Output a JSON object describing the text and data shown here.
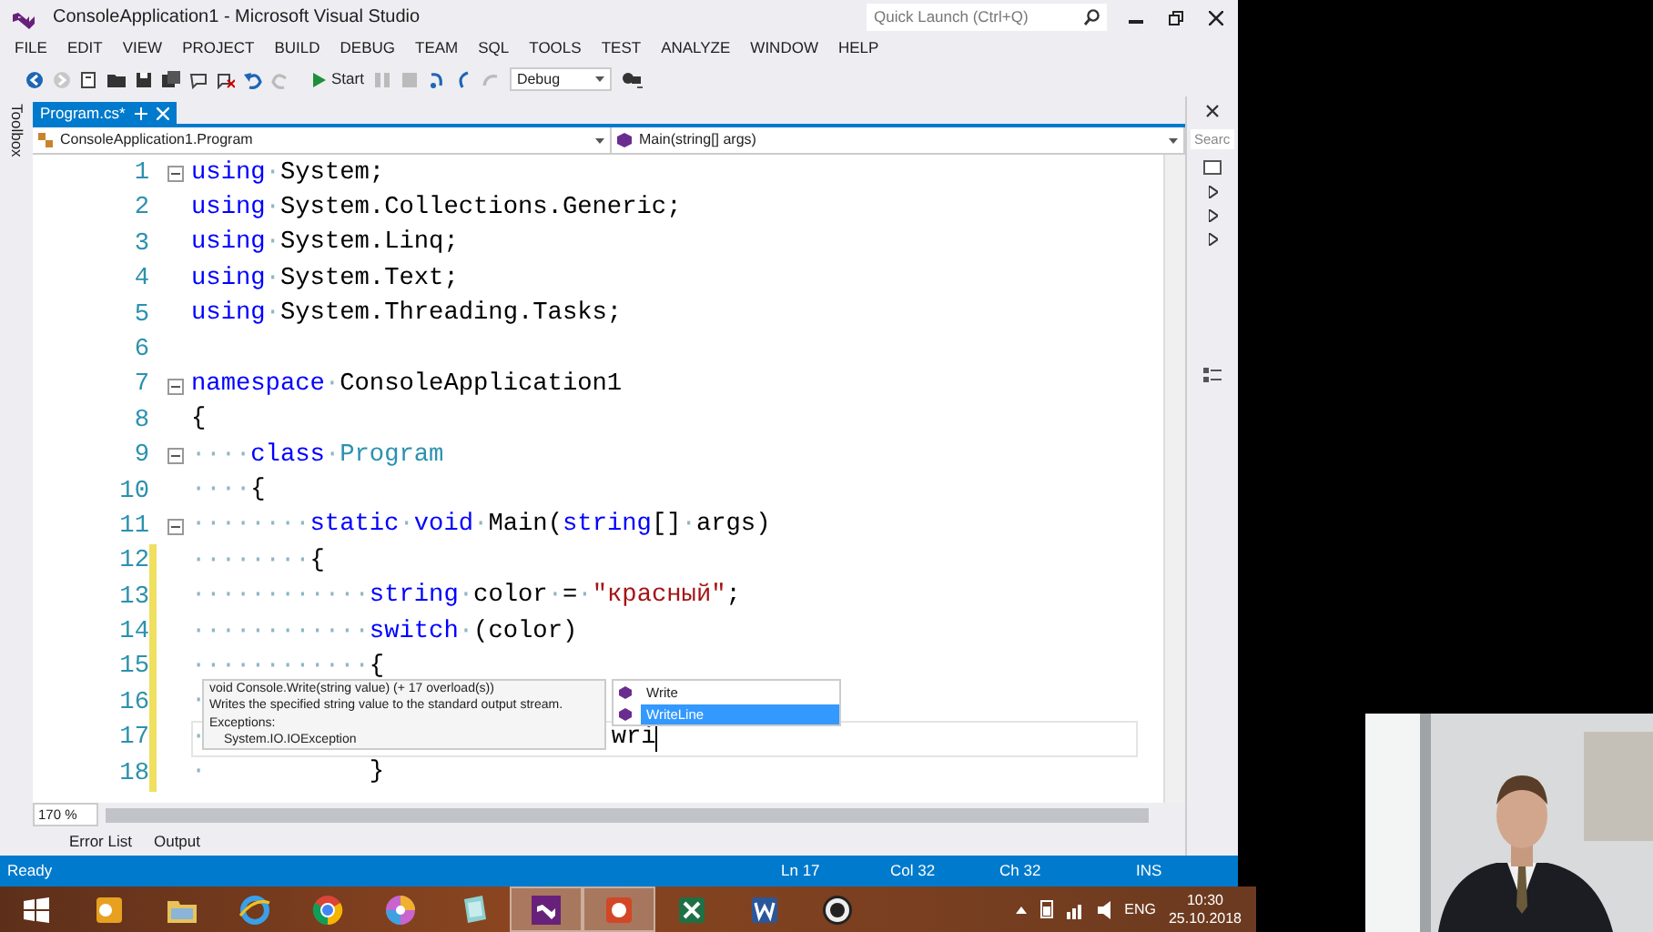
{
  "window": {
    "title": "ConsoleApplication1 - Microsoft Visual Studio",
    "quick_launch": {
      "placeholder": "Quick Launch (Ctrl+Q)"
    }
  },
  "menu": [
    "FILE",
    "EDIT",
    "VIEW",
    "PROJECT",
    "BUILD",
    "DEBUG",
    "TEAM",
    "SQL",
    "TOOLS",
    "TEST",
    "ANALYZE",
    "WINDOW",
    "HELP"
  ],
  "toolbar": {
    "start": "Start",
    "configuration": "Debug"
  },
  "toolbox_label": "Toolbox",
  "tabs": [
    {
      "label": "Program.cs*",
      "selected": true
    }
  ],
  "nav": {
    "type": "ConsoleApplication1.Program",
    "member": "Main(string[] args)"
  },
  "code": [
    {
      "number": "1",
      "fold": true,
      "changed": false,
      "current": false,
      "tokens": [
        {
          "kind": "keyword",
          "text": "using"
        },
        {
          "kind": "ws",
          "text": "·"
        },
        {
          "kind": "plain",
          "text": "System;"
        }
      ]
    },
    {
      "number": "2",
      "fold": false,
      "changed": false,
      "current": false,
      "tokens": [
        {
          "kind": "keyword",
          "text": "using"
        },
        {
          "kind": "ws",
          "text": "·"
        },
        {
          "kind": "plain",
          "text": "System.Collections.Generic;"
        }
      ]
    },
    {
      "number": "3",
      "fold": false,
      "changed": false,
      "current": false,
      "tokens": [
        {
          "kind": "keyword",
          "text": "using"
        },
        {
          "kind": "ws",
          "text": "·"
        },
        {
          "kind": "plain",
          "text": "System.Linq;"
        }
      ]
    },
    {
      "number": "4",
      "fold": false,
      "changed": false,
      "current": false,
      "tokens": [
        {
          "kind": "keyword",
          "text": "using"
        },
        {
          "kind": "ws",
          "text": "·"
        },
        {
          "kind": "plain",
          "text": "System.Text;"
        }
      ]
    },
    {
      "number": "5",
      "fold": false,
      "changed": false,
      "current": false,
      "tokens": [
        {
          "kind": "keyword",
          "text": "using"
        },
        {
          "kind": "ws",
          "text": "·"
        },
        {
          "kind": "plain",
          "text": "System.Threading.Tasks;"
        }
      ]
    },
    {
      "number": "6",
      "fold": false,
      "changed": false,
      "current": false
    },
    {
      "number": "7",
      "fold": true,
      "changed": false,
      "current": false,
      "tokens": [
        {
          "kind": "keyword",
          "text": "namespace"
        },
        {
          "kind": "ws",
          "text": "·"
        },
        {
          "kind": "plain",
          "text": "ConsoleApplication1"
        }
      ]
    },
    {
      "number": "8",
      "fold": false,
      "changed": false,
      "current": false,
      "tokens": [
        {
          "kind": "plain",
          "text": "{"
        }
      ]
    },
    {
      "number": "9",
      "fold": true,
      "changed": false,
      "current": false,
      "tokens": [
        {
          "kind": "ws",
          "text": "····"
        },
        {
          "kind": "keyword",
          "text": "class"
        },
        {
          "kind": "ws",
          "text": "·"
        },
        {
          "kind": "type",
          "text": "Program"
        }
      ]
    },
    {
      "number": "10",
      "fold": false,
      "changed": false,
      "current": false,
      "tokens": [
        {
          "kind": "ws",
          "text": "····"
        },
        {
          "kind": "plain",
          "text": "{"
        }
      ]
    },
    {
      "number": "11",
      "fold": true,
      "changed": false,
      "current": false,
      "tokens": [
        {
          "kind": "ws",
          "text": "········"
        },
        {
          "kind": "keyword",
          "text": "static"
        },
        {
          "kind": "ws",
          "text": "·"
        },
        {
          "kind": "keyword",
          "text": "void"
        },
        {
          "kind": "ws",
          "text": "·"
        },
        {
          "kind": "plain",
          "text": "Main("
        },
        {
          "kind": "keyword",
          "text": "string"
        },
        {
          "kind": "plain",
          "text": "[]"
        },
        {
          "kind": "ws",
          "text": "·"
        },
        {
          "kind": "plain",
          "text": "args)"
        }
      ]
    },
    {
      "number": "12",
      "fold": false,
      "changed": true,
      "current": false,
      "tokens": [
        {
          "kind": "ws",
          "text": "········"
        },
        {
          "kind": "plain",
          "text": "{"
        }
      ]
    },
    {
      "number": "13",
      "fold": false,
      "changed": true,
      "current": false,
      "tokens": [
        {
          "kind": "ws",
          "text": "············"
        },
        {
          "kind": "keyword",
          "text": "string"
        },
        {
          "kind": "ws",
          "text": "·"
        },
        {
          "kind": "plain",
          "text": "color"
        },
        {
          "kind": "ws",
          "text": "·"
        },
        {
          "kind": "plain",
          "text": "="
        },
        {
          "kind": "ws",
          "text": "·"
        },
        {
          "kind": "string",
          "text": "\"красный\""
        },
        {
          "kind": "plain",
          "text": ";"
        }
      ]
    },
    {
      "number": "14",
      "fold": false,
      "changed": true,
      "current": false,
      "tokens": [
        {
          "kind": "ws",
          "text": "············"
        },
        {
          "kind": "keyword",
          "text": "switch"
        },
        {
          "kind": "ws",
          "text": "·"
        },
        {
          "kind": "plain",
          "text": "(color)"
        }
      ]
    },
    {
      "number": "15",
      "fold": false,
      "changed": true,
      "current": false,
      "tokens": [
        {
          "kind": "ws",
          "text": "············"
        },
        {
          "kind": "plain",
          "text": "{"
        }
      ]
    },
    {
      "number": "16",
      "fold": false,
      "changed": true,
      "current": false,
      "tokens": [
        {
          "kind": "ws",
          "text": "·"
        }
      ]
    },
    {
      "number": "17",
      "fold": false,
      "changed": true,
      "current": true,
      "tokens": [
        {
          "kind": "ws",
          "text": "·"
        },
        {
          "kind": "plain",
          "text": "wri"
        }
      ]
    },
    {
      "number": "18",
      "fold": false,
      "changed": true,
      "current": false,
      "tokens": [
        {
          "kind": "ws",
          "text": "·"
        },
        {
          "kind": "plain",
          "text": "}"
        }
      ]
    }
  ],
  "completion": [
    {
      "label": "Write",
      "selected": false
    },
    {
      "label": "WriteLine",
      "selected": true
    }
  ],
  "tooltip": {
    "signature": "void Console.Write(string value)  (+ 17 overload(s))",
    "summary": "Writes the specified string value to the standard output stream.",
    "exceptions_label": "Exceptions:",
    "exceptions": [
      "System.IO.IOException"
    ]
  },
  "zoom": "170 %",
  "side_panel": {
    "search_placeholder": "Searc"
  },
  "tool_tabs": [
    "Error List",
    "Output"
  ],
  "status_bar": {
    "state": "Ready",
    "line": "Ln 17",
    "col": "Col 32",
    "ch": "Ch 32",
    "mode": "INS"
  },
  "taskbar": {
    "apps": [
      {
        "kind": "outlook",
        "selected": false
      },
      {
        "kind": "explorer",
        "selected": false
      },
      {
        "kind": "ie",
        "selected": false
      },
      {
        "kind": "chrome",
        "selected": false
      },
      {
        "kind": "picasa",
        "selected": false
      },
      {
        "kind": "notes",
        "selected": false
      },
      {
        "kind": "vs",
        "selected": true
      },
      {
        "kind": "powerpoint",
        "selected": true
      },
      {
        "kind": "excel",
        "selected": false
      },
      {
        "kind": "word",
        "selected": false
      },
      {
        "kind": "obs",
        "selected": false
      }
    ],
    "language": "ENG",
    "time": "10:30",
    "date": "25.10.2018"
  },
  "webcam": {
    "kind": "picture"
  }
}
